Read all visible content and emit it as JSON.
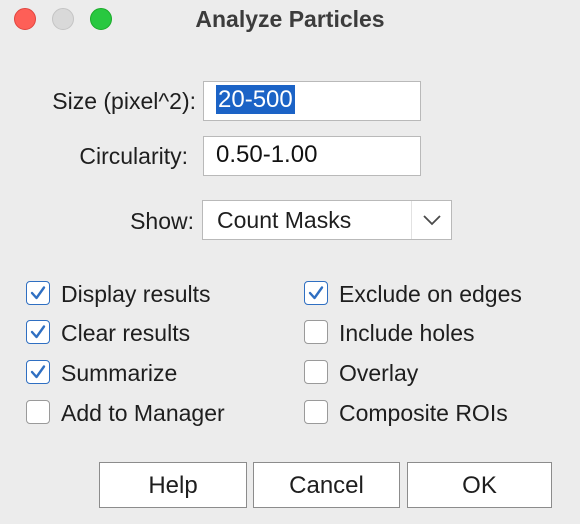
{
  "window": {
    "title": "Analyze Particles"
  },
  "fields": {
    "size_label": "Size (pixel^2):",
    "size_value": "20-500",
    "circularity_label": "Circularity:",
    "circularity_value": "0.50-1.00"
  },
  "show": {
    "label": "Show:",
    "selected": "Count Masks"
  },
  "checkboxes": [
    {
      "label": "Display results",
      "checked": true
    },
    {
      "label": "Clear results",
      "checked": true
    },
    {
      "label": "Summarize",
      "checked": true
    },
    {
      "label": "Add to Manager",
      "checked": false
    },
    {
      "label": "Exclude on edges",
      "checked": true
    },
    {
      "label": "Include holes",
      "checked": false
    },
    {
      "label": "Overlay",
      "checked": false
    },
    {
      "label": "Composite ROIs",
      "checked": false
    }
  ],
  "buttons": {
    "help": "Help",
    "cancel": "Cancel",
    "ok": "OK"
  },
  "colors": {
    "accent": "#2f6fc2",
    "selection": "#1b63c6",
    "close": "#fe5f57",
    "minimize": "#d9d9d9",
    "maximize": "#28c840"
  }
}
